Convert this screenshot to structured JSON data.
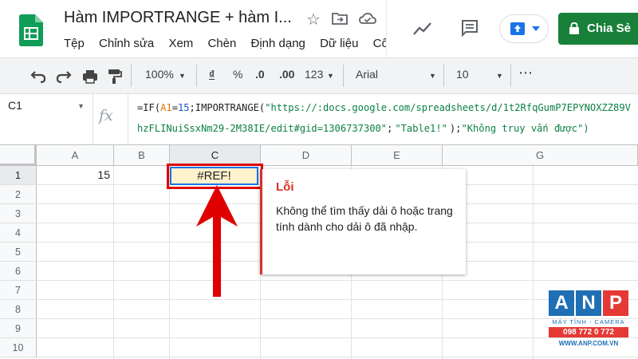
{
  "header": {
    "doc_title": "Hàm IMPORTRANGE + hàm I...",
    "menu": [
      "Tệp",
      "Chỉnh sửa",
      "Xem",
      "Chèn",
      "Định dạng",
      "Dữ liệu",
      "Cô"
    ],
    "share_label": "Chia Sẻ"
  },
  "toolbar": {
    "zoom": "100%",
    "currency": "₫",
    "percent": "%",
    "dec_decrease": ".0",
    "dec_increase": ".00",
    "more_formats": "123",
    "font": "Arial",
    "font_size": "10",
    "more": "⋯"
  },
  "formula_bar": {
    "cell_ref": "C1",
    "fx": "fx",
    "formula": {
      "p1": "=IF(",
      "ref": "A1",
      "p2": "=",
      "num": "15",
      "p3": ";IMPORTRANGE(",
      "url": "\"https://:docs.google.com/spreadsheets/d/1t2RfqGumP7EPYNOXZZ89VhzFLINuiSsxNm29-2M38IE/edit#gid=1306737300\"",
      "p4": ";",
      "range": "\"Table1!\"",
      "p5": ");",
      "fallback": "\"Không truy vấn được\")"
    }
  },
  "grid": {
    "columns": [
      "A",
      "B",
      "C",
      "D",
      "E",
      "G"
    ],
    "rows": [
      "1",
      "2",
      "3",
      "4",
      "5",
      "6",
      "7",
      "8",
      "9",
      "10"
    ],
    "cells": {
      "A1": "15",
      "C1": "#REF!"
    }
  },
  "error_popup": {
    "title": "Lỗi",
    "message": "Không thể tìm thấy dải ô hoặc trang tính dành cho dải ô đã nhập."
  },
  "watermark": {
    "letters": [
      "A",
      "N",
      "P"
    ],
    "tagline": "MÁY TÍNH - CAMERA",
    "phone": "098 772 0 772",
    "website": "WWW.ANP.COM.VN"
  },
  "colors": {
    "share_green": "#188038",
    "error_red": "#d93025",
    "annotation_red": "#e00000",
    "selected_cell_fill": "#fff2cc",
    "selection_blue": "#1a73e8"
  }
}
